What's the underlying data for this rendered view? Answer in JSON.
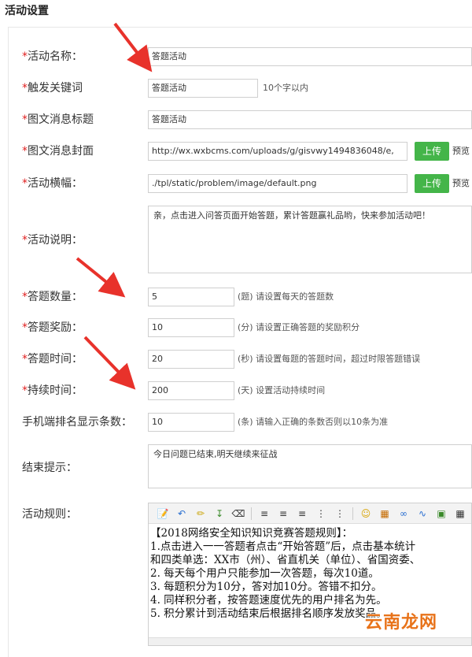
{
  "section_title": "活动设置",
  "fields": {
    "activity_name": {
      "label": "活动名称：",
      "value": "答题活动"
    },
    "keyword": {
      "label": "触发关键词",
      "value": "答题活动",
      "hint": "10个字以内"
    },
    "news_title": {
      "label": "图文消息标题",
      "value": "答题活动"
    },
    "news_cover": {
      "label": "图文消息封面",
      "value": "http://wx.wxbcms.com/uploads/g/gisvwy1494836048/e,",
      "upload": "上传",
      "preview": "预览"
    },
    "banner": {
      "label": "活动横幅：",
      "value": "./tpl/static/problem/image/default.png",
      "upload": "上传",
      "preview": "预览"
    },
    "description": {
      "label": "活动说明：",
      "value": "亲，点击进入问答页面开始答题，累计答题赢礼品哟，快来参加活动吧！"
    },
    "question_count": {
      "label": "答题数量：",
      "value": "5",
      "hint": "(题) 请设置每天的答题数"
    },
    "reward": {
      "label": "答题奖励：",
      "value": "10",
      "hint": "(分) 请设置正确答题的奖励积分"
    },
    "answer_time": {
      "label": "答题时间：",
      "value": "20",
      "hint": "(秒) 请设置每题的答题时间，超过时限答题错误"
    },
    "duration": {
      "label": "持续时间：",
      "value": "200",
      "hint": "(天) 设置活动持续时间"
    },
    "rank_count": {
      "label": "手机端排名显示条数：",
      "value": "10",
      "hint": "(条) 请输入正确的条数否则以10条为准"
    },
    "end_tip": {
      "label": "结束提示：",
      "value": "今日问题已结束,明天继续来征战"
    },
    "rules": {
      "label": "活动规则：",
      "lines": [
        "【2018网络安全知识知识竞赛答题规则】：",
        "1.点击进入一一答题者点击“开始答题”后，点击基本统计",
        "和四类单选：XX市（州）、省直机关（单位）、省国资委、",
        "2.  每天每个用户只能参加一次答题，每次10道。",
        "3.  每题积分为10分，答对加10分。答错不扣分。",
        "4.  同样积分者，按答题速度优先的用户排名为先。",
        "5.  积分累计到活动结束后根据排名顺序发放奖品。"
      ]
    }
  },
  "toolbar_icons": [
    "source-icon",
    "undo-icon",
    "clear-format-icon",
    "insert-row-icon",
    "eraser-icon",
    "align-left-icon",
    "align-center-icon",
    "align-right-icon",
    "ordered-list-icon",
    "unordered-list-icon",
    "emoticon-icon",
    "insert-image-icon",
    "link-icon",
    "unlink-icon",
    "image-icon",
    "table-icon"
  ],
  "watermark": "云南龙网",
  "colors": {
    "required": "#e02020",
    "upload_button": "#44b549",
    "arrow": "#e8322b"
  }
}
